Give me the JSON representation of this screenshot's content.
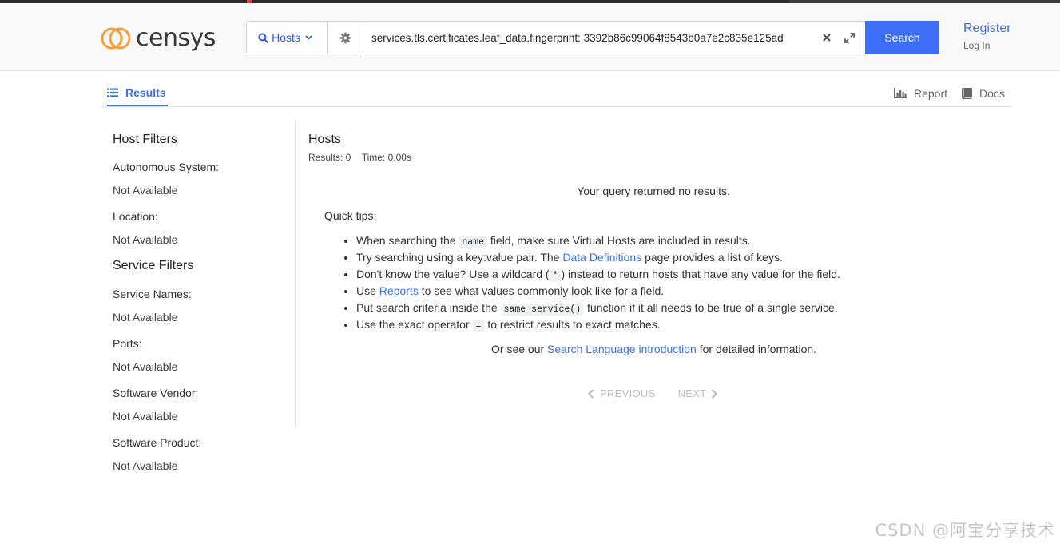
{
  "header": {
    "logo_text": "censys",
    "scope_label": "Hosts",
    "query_value": "services.tls.certificates.leaf_data.fingerprint: 3392b86c99064f8543b0a7e2c835e125ad",
    "search_label": "Search",
    "register_label": "Register",
    "login_label": "Log In"
  },
  "tabs": {
    "results_label": "Results",
    "report_label": "Report",
    "docs_label": "Docs"
  },
  "sidebar": {
    "host_filters_heading": "Host Filters",
    "service_filters_heading": "Service Filters",
    "filters": [
      {
        "label": "Autonomous System:",
        "value": "Not Available"
      },
      {
        "label": "Location:",
        "value": "Not Available"
      },
      {
        "label": "Service Names:",
        "value": "Not Available"
      },
      {
        "label": "Ports:",
        "value": "Not Available"
      },
      {
        "label": "Software Vendor:",
        "value": "Not Available"
      },
      {
        "label": "Software Product:",
        "value": "Not Available"
      }
    ]
  },
  "main": {
    "title": "Hosts",
    "results_count": "Results: 0",
    "time": "Time: 0.00s",
    "no_results": "Your query returned no results.",
    "quick_tips_label": "Quick tips:",
    "tips": [
      {
        "pre": "When searching the ",
        "code": "name",
        "post": " field, make sure Virtual Hosts are included in results."
      },
      {
        "pre": "Try searching using a key:value pair. The ",
        "link": "Data Definitions",
        "post": " page provides a list of keys."
      },
      {
        "pre": "Don't know the value? Use a wildcard (",
        "code": "*",
        "post": ") instead to return hosts that have any value for the field."
      },
      {
        "pre": "Use ",
        "link": "Reports",
        "post": " to see what values commonly look like for a field."
      },
      {
        "pre": "Put search criteria inside the ",
        "code": "same_service()",
        "post": " function if it all needs to be true of a single service."
      },
      {
        "pre": "Use the exact operator ",
        "code": "=",
        "post": " to restrict results to exact matches."
      }
    ],
    "see_our_pre": "Or see our ",
    "see_our_link": "Search Language introduction",
    "see_our_post": " for detailed information.",
    "prev_label": "PREVIOUS",
    "next_label": "NEXT"
  },
  "watermark": "CSDN @阿宝分享技术",
  "colors": {
    "accent": "#3d72d6",
    "search_button": "#3f6ef6",
    "logo_orange": "#f5a03a"
  }
}
